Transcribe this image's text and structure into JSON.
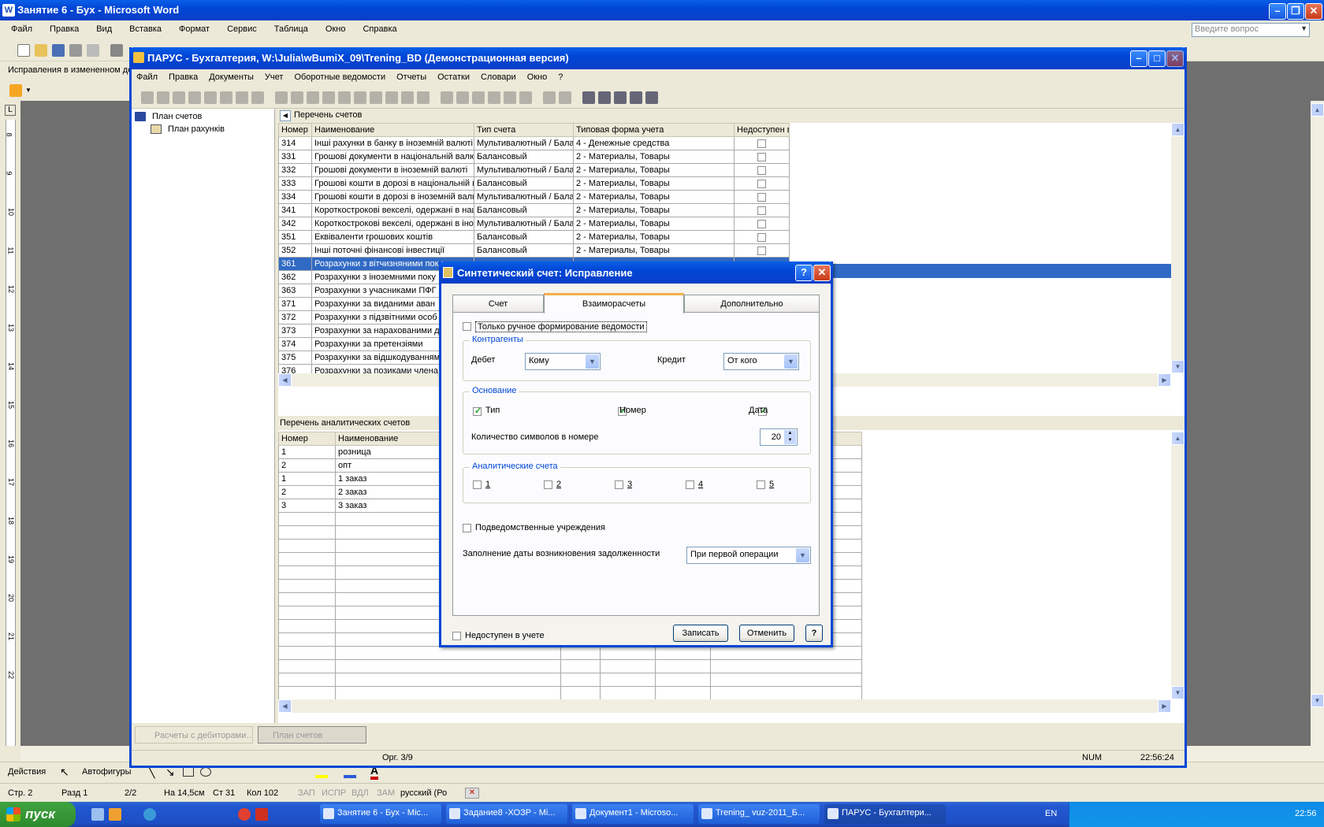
{
  "word": {
    "title": "Занятие 6 - Бух - Microsoft Word",
    "menu": [
      "Файл",
      "Правка",
      "Вид",
      "Вставка",
      "Формат",
      "Сервис",
      "Таблица",
      "Окно",
      "Справка"
    ],
    "help_placeholder": "Введите вопрос",
    "tracking_bar": "Исправления в измененном до",
    "ruler_numbers": [
      "8",
      "9",
      "10",
      "11",
      "12",
      "13",
      "14",
      "15",
      "16",
      "17",
      "18",
      "19",
      "20",
      "21",
      "22"
    ],
    "draw_toolbar": {
      "actions": "Действия",
      "autoshapes": "Автофигуры"
    },
    "status": {
      "page": "Стр. 2",
      "section": "Разд 1",
      "pages": "2/2",
      "at": "На 14,5см",
      "line": "Ст 31",
      "col": "Кол 102",
      "rec": "ЗАП",
      "track": "ИСПР",
      "ext": "ВДЛ",
      "ovr": "ЗАМ",
      "lang": "русский (Ро"
    }
  },
  "parus": {
    "title": "ПАРУС - Бухгалтерия, W:\\Julia\\wBumiX_09\\Trening_BD (Демонстрационная версия)",
    "menu": [
      "Файл",
      "Правка",
      "Документы",
      "Учет",
      "Оборотные ведомости",
      "Отчеты",
      "Остатки",
      "Словари",
      "Окно",
      "?"
    ],
    "tree": {
      "root": "План счетов",
      "child": "План рахунків"
    },
    "accounts_panel_title": "Перечень счетов",
    "accounts_columns": [
      "Номер",
      "Наименование",
      "Тип счета",
      "Типовая форма учета",
      "Недоступен в у"
    ],
    "accounts": [
      {
        "num": "314",
        "name": "Інші рахунки в банку в іноземній валюті",
        "type": "Мультивалютный / Балан",
        "form": "4 - Денежные средства"
      },
      {
        "num": "331",
        "name": "Грошові документи в національній валюті",
        "type": "Балансовый",
        "form": "2 - Материалы, Товары"
      },
      {
        "num": "332",
        "name": "Грошові документи в іноземній валюті",
        "type": "Мультивалютный / Балан",
        "form": "2 - Материалы, Товары"
      },
      {
        "num": "333",
        "name": "Грошові кошти в дорозі в національній вал",
        "type": "Балансовый",
        "form": "2 - Материалы, Товары"
      },
      {
        "num": "334",
        "name": "Грошові кошти в дорозі в іноземній валюті",
        "type": "Мультивалютный / Балан",
        "form": "2 - Материалы, Товары"
      },
      {
        "num": "341",
        "name": "Короткострокові векселі, одержані в націо",
        "type": "Балансовый",
        "form": "2 - Материалы, Товары"
      },
      {
        "num": "342",
        "name": "Короткострокові векселі, одержані в інозе",
        "type": "Мультивалютный / Балан",
        "form": "2 - Материалы, Товары"
      },
      {
        "num": "351",
        "name": "Еквіваленти грошових коштів",
        "type": "Балансовый",
        "form": "2 - Материалы, Товары"
      },
      {
        "num": "352",
        "name": "Інші поточні фінансові інвестиції",
        "type": "Балансовый",
        "form": "2 - Материалы, Товары"
      },
      {
        "num": "361",
        "name": "Розрахунки з вітчизняними пок",
        "type": "",
        "form": ""
      },
      {
        "num": "362",
        "name": "Розрахунки з іноземними поку",
        "type": "",
        "form": ""
      },
      {
        "num": "363",
        "name": "Розрахунки з учасниками ПФГ",
        "type": "",
        "form": ""
      },
      {
        "num": "371",
        "name": "Розрахунки за виданими аван",
        "type": "",
        "form": ""
      },
      {
        "num": "372",
        "name": "Розрахунки з підзвітними особ",
        "type": "",
        "form": ""
      },
      {
        "num": "373",
        "name": "Розрахунки за нарахованими д",
        "type": "",
        "form": ""
      },
      {
        "num": "374",
        "name": "Розрахунки за претензіями",
        "type": "",
        "form": ""
      },
      {
        "num": "375",
        "name": "Розрахунки за відшкодуванням",
        "type": "",
        "form": ""
      },
      {
        "num": "376",
        "name": "Розрахунки за позиками члена",
        "type": "",
        "form": ""
      }
    ],
    "analytics_panel_title": "Перечень аналитических счетов",
    "analytics_columns": [
      "Номер",
      "Наименование"
    ],
    "analytics": [
      {
        "num": "1",
        "name": "розница"
      },
      {
        "num": "2",
        "name": "опт"
      },
      {
        "num": "1",
        "name": "1 заказ"
      },
      {
        "num": "2",
        "name": "2 заказ"
      },
      {
        "num": "3",
        "name": "3 заказ"
      }
    ],
    "bottom_tabs": [
      "Расчеты с дебиторами...",
      "План счетов"
    ],
    "status": {
      "record": "Орг. 3/9",
      "num": "NUM",
      "time": "22:56:24"
    }
  },
  "dialog": {
    "title": "Синтетический счет: Исправление",
    "tabs": [
      "Счет",
      "Взаиморасчеты",
      "Дополнительно"
    ],
    "manual_only": "Только ручное формирование ведомости",
    "contragents": {
      "title": "Контрагенты",
      "debit_label": "Дебет",
      "debit_value": "Кому",
      "credit_label": "Кредит",
      "credit_value": "От кого"
    },
    "basis": {
      "title": "Основание",
      "type": "Тип",
      "number": "Номер",
      "date": "Дата",
      "chars_label": "Количество символов в номере",
      "chars_value": "20"
    },
    "analytic": {
      "title": "Аналитические счета",
      "items": [
        "1",
        "2",
        "3",
        "4",
        "5"
      ]
    },
    "subordinate": "Подведомственные учреждения",
    "debt_date_label": "Заполнение даты возникновения задолженности",
    "debt_date_value": "При первой операции",
    "unavailable": "Недоступен в учете",
    "save": "Записать",
    "cancel": "Отменить",
    "help": "?"
  },
  "taskbar": {
    "start": "пуск",
    "items": [
      "Занятие 6 - Бух - Mic...",
      "Задание8 -ХОЗР - Mi...",
      "Документ1 - Microso...",
      "Trening_ vuz-2011_Б...",
      "ПАРУС - Бухгалтери..."
    ],
    "lang": "EN",
    "clock": "22:56"
  }
}
